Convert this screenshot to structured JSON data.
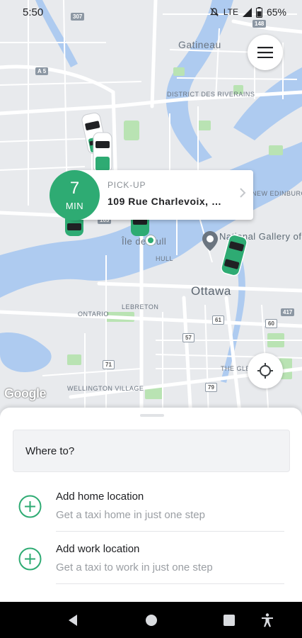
{
  "status_bar": {
    "time": "5:50",
    "network": "LTE",
    "battery": "65%"
  },
  "map": {
    "labels": {
      "gatineau": "Gatineau",
      "district": "DISTRICT DES RIVERAINS",
      "new_edinburgh": "NEW EDINBURGH",
      "national_gallery": "National Gallery of Canada",
      "ile_de_hull": "Île de Hull",
      "hull": "HULL",
      "ottawa": "Ottawa",
      "ontario": "ONTARIO",
      "lebreton": "LEBRETON",
      "the_glebe": "THE GLEBE",
      "wellington_village": "WELLINGTON VILLAGE"
    },
    "shields": {
      "r307": "307",
      "r148": "148",
      "a5": "A 5",
      "r105": "105",
      "r417": "417",
      "r71": "71",
      "r79": "79",
      "r57": "57",
      "r61": "61",
      "r60": "60"
    },
    "google_logo": "Google",
    "accent_color": "#2eab73"
  },
  "pickup": {
    "eta_value": "7",
    "eta_unit": "MIN",
    "label": "PICK-UP",
    "address": "109 Rue Charlevoix, …"
  },
  "sheet": {
    "search_placeholder": "Where to?",
    "shortcuts": [
      {
        "title": "Add home location",
        "subtitle": "Get a taxi home in just one step"
      },
      {
        "title": "Add work location",
        "subtitle": "Get a taxi to work in just one step"
      }
    ]
  },
  "icons": {
    "menu": "menu-icon",
    "locate": "my-location-icon",
    "plus": "add-circle-icon",
    "back": "back-icon",
    "home": "home-icon",
    "recents": "recents-icon",
    "accessibility": "accessibility-icon"
  }
}
